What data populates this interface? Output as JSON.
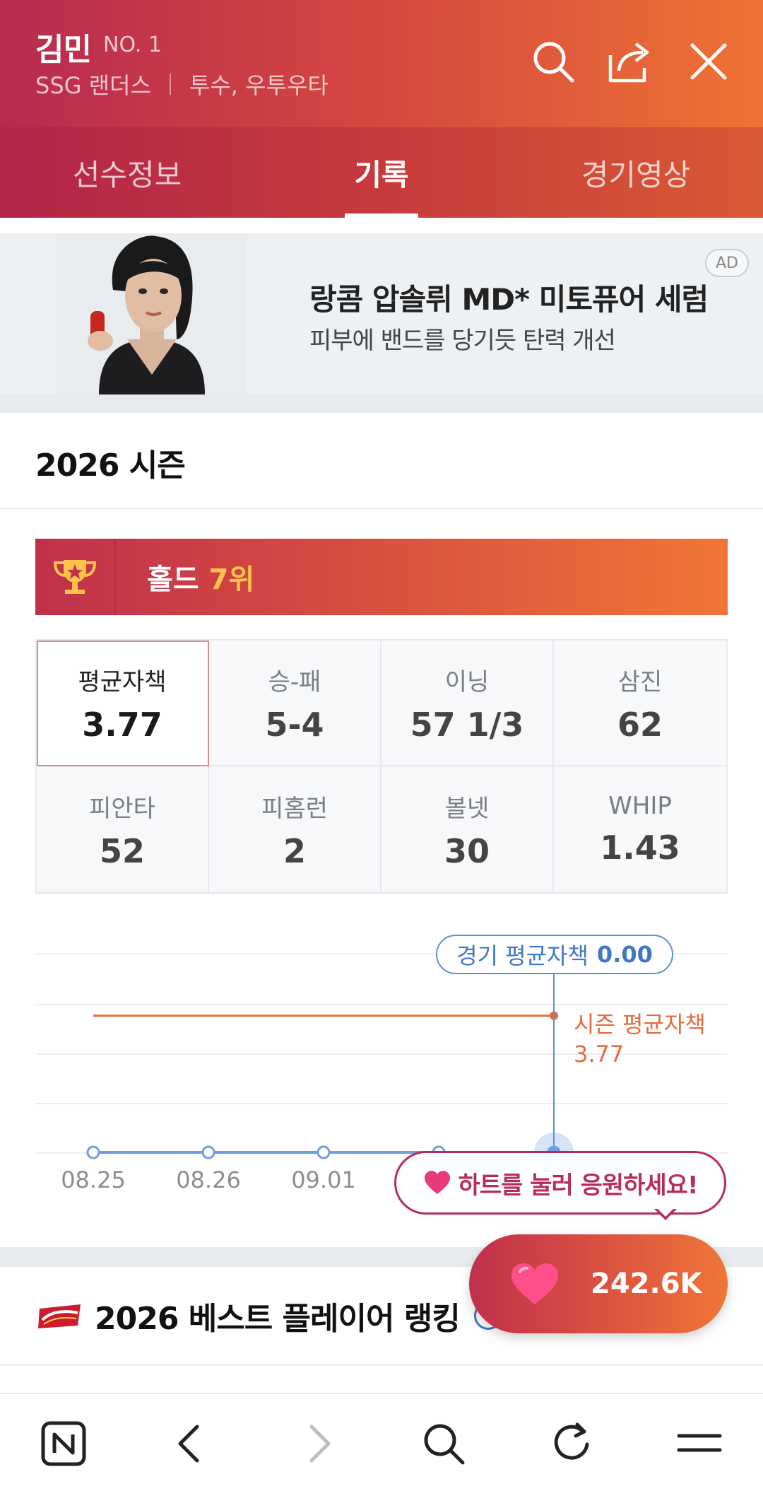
{
  "header": {
    "player_name": "김민",
    "player_number": "NO. 1",
    "team": "SSG 랜더스",
    "position": "투수, 우투우타",
    "icons": [
      "search-icon",
      "share-icon",
      "close-icon"
    ]
  },
  "tabs": [
    {
      "label": "선수정보",
      "active": false
    },
    {
      "label": "기록",
      "active": true
    },
    {
      "label": "경기영상",
      "active": false
    }
  ],
  "ad": {
    "title": "랑콤 압솔뤼 MD* 미토퓨어 세럼",
    "subtitle": "피부에 밴드를 당기듯 탄력 개선",
    "badge": "AD"
  },
  "season": {
    "title": "2026 시즌",
    "rank_label": "홀드",
    "rank_value": "7위",
    "stats": [
      {
        "label": "평균자책",
        "value": "3.77",
        "selected": true
      },
      {
        "label": "승-패",
        "value": "5-4"
      },
      {
        "label": "이닝",
        "value": "57 1/3"
      },
      {
        "label": "삼진",
        "value": "62"
      },
      {
        "label": "피안타",
        "value": "52"
      },
      {
        "label": "피홈런",
        "value": "2"
      },
      {
        "label": "볼넷",
        "value": "30"
      },
      {
        "label": "WHIP",
        "value": "1.43"
      }
    ]
  },
  "chart_data": {
    "type": "line",
    "categories": [
      "08.25",
      "08.26",
      "09.01",
      "",
      ""
    ],
    "series": [
      {
        "name": "경기 평균자책",
        "values": [
          0.0,
          0.0,
          0.0,
          0.0,
          0.0
        ]
      }
    ],
    "reference_line": {
      "name": "시즌 평균자책",
      "value": 3.77
    },
    "tooltip": {
      "label": "경기 평균자책",
      "value": "0.00"
    },
    "season_label": {
      "line1": "시즌 평균자책",
      "line2": "3.77"
    },
    "grid": true,
    "colors": {
      "game": "#6f9de6",
      "season": "#e76a3c"
    }
  },
  "cheer": {
    "bubble_text": "하트를 눌러 응원하세요!",
    "heart_count": "242.6K"
  },
  "ranking": {
    "title": "2026 베스트 플레이어 랭킹",
    "info_icon": "i"
  },
  "bottom_nav": [
    "naver-home-icon",
    "back-icon",
    "forward-icon",
    "search-icon",
    "refresh-icon",
    "menu-icon"
  ],
  "colors": {
    "brand_red": "#b82a4f",
    "brand_orange": "#ee7334",
    "rank_gold": "#ffc24a",
    "chart_blue": "#5b8fd8"
  }
}
